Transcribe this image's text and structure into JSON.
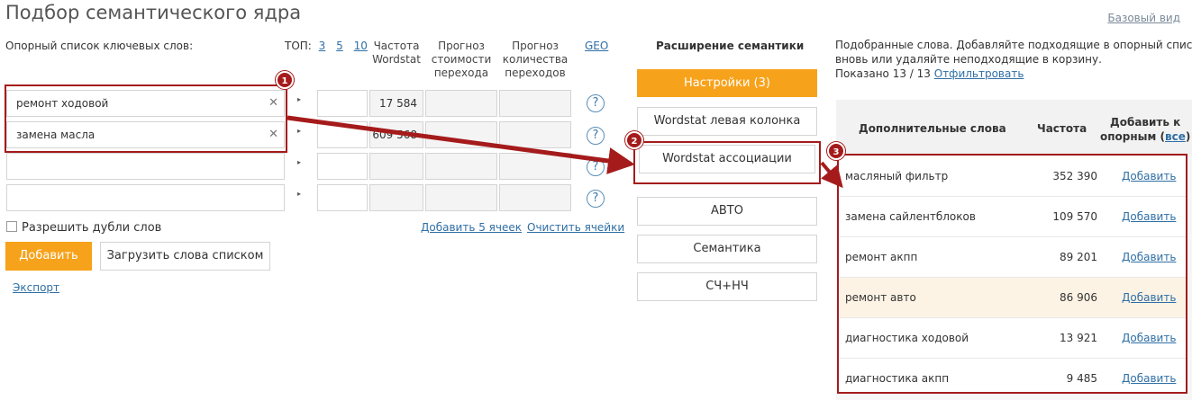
{
  "page_title": "Подбор семантического ядра",
  "basic_view_link": "Базовый вид",
  "left": {
    "keywords_label": "Опорный список ключевых слов:",
    "top_label": "ТОП:",
    "top_options": [
      "3",
      "5",
      "10"
    ],
    "col_freq": "Частота Wordstat",
    "col_cost": "Прогноз стоимости перехода",
    "col_count": "Прогноз количества переходов",
    "col_geo": "GEO",
    "rows": [
      {
        "value": "ремонт ходовой",
        "freq": "17 584"
      },
      {
        "value": "замена масла",
        "freq": "609 568"
      },
      {
        "value": "",
        "freq": ""
      },
      {
        "value": "",
        "freq": ""
      }
    ],
    "help_icon": "?",
    "allow_dupes": "Разрешить дубли слов",
    "add_cells": "Добавить 5 ячеек",
    "clear_cells": "Очистить ячейки",
    "add_button": "Добавить",
    "load_button": "Загрузить слова списком",
    "export_link": "Экспорт"
  },
  "middle": {
    "heading": "Расширение семантики",
    "buttons": [
      "Настройки (3)",
      "Wordstat левая колонка",
      "Wordstat ассоциации",
      "АВТО",
      "Семантика",
      "СЧ+НЧ"
    ]
  },
  "right": {
    "info_line1": "Подобранные слова. Добавляйте подходящие в опорный список и",
    "info_line2": "вновь или удаляйте неподходящие в корзину.",
    "shown_label": "Показано 13 / 13",
    "filter_link": "Отфильтровать",
    "col_words": "Дополнительные слова",
    "col_freq": "Частота",
    "col_add_line1": "Добавить к",
    "col_add_line2_prefix": "опорным (",
    "col_add_all": "все",
    "col_add_line2_suffix": ")",
    "rows": [
      {
        "word": "масляный фильтр",
        "freq": "352 390",
        "action": "Добавить"
      },
      {
        "word": "замена сайлентблоков",
        "freq": "109 570",
        "action": "Добавить"
      },
      {
        "word": "ремонт акпп",
        "freq": "89 201",
        "action": "Добавить"
      },
      {
        "word": "ремонт авто",
        "freq": "86 906",
        "action": "Добавить"
      },
      {
        "word": "диагностика ходовой",
        "freq": "13 921",
        "action": "Добавить"
      },
      {
        "word": "диагностика акпп",
        "freq": "9 485",
        "action": "Добавить"
      }
    ]
  },
  "badges": [
    "1",
    "2",
    "3"
  ],
  "colors": {
    "accent": "#f7a21b",
    "annotation": "#a51b1b",
    "link": "#2f6fa5",
    "highlight_row": "#fdf3e5"
  }
}
